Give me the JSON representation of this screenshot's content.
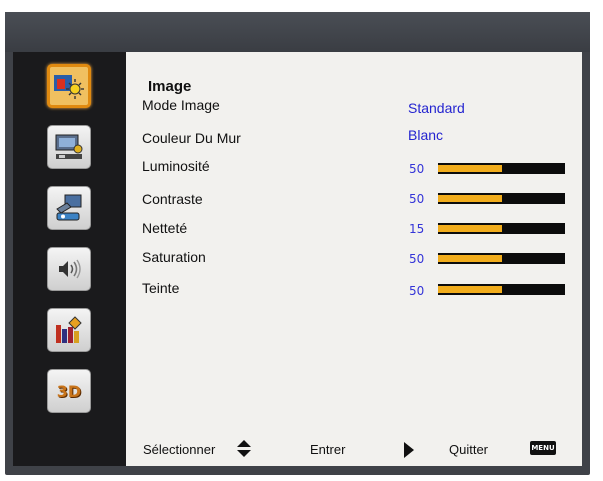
{
  "sidebar": {
    "items": [
      {
        "icon": "image-settings-icon",
        "active": true
      },
      {
        "icon": "display-settings-icon",
        "active": false
      },
      {
        "icon": "setup-icon",
        "active": false
      },
      {
        "icon": "volume-icon",
        "active": false
      },
      {
        "icon": "options-icon",
        "active": false
      },
      {
        "icon": "3d-icon",
        "label": "3D",
        "active": false
      }
    ]
  },
  "main": {
    "title": "Image",
    "rows": [
      {
        "label": "Mode Image",
        "value": "Standard"
      },
      {
        "label": "Couleur Du Mur",
        "value": "Blanc"
      },
      {
        "label": "Luminosité",
        "level": "50",
        "fraction": 0.5
      },
      {
        "label": "Contraste",
        "level": "50",
        "fraction": 0.5
      },
      {
        "label": "Netteté",
        "level": "15",
        "fraction": 0.5
      },
      {
        "label": "Saturation",
        "level": "50",
        "fraction": 0.5
      },
      {
        "label": "Teinte",
        "level": "50",
        "fraction": 0.5
      }
    ]
  },
  "footer": {
    "select_label": "Sélectionner",
    "enter_label": "Entrer",
    "quit_label": "Quitter",
    "menu_key": "MENU"
  },
  "colors": {
    "accent": "#f2ad1c",
    "value_text": "#2424d0",
    "bar_background": "#0c0c0c"
  }
}
